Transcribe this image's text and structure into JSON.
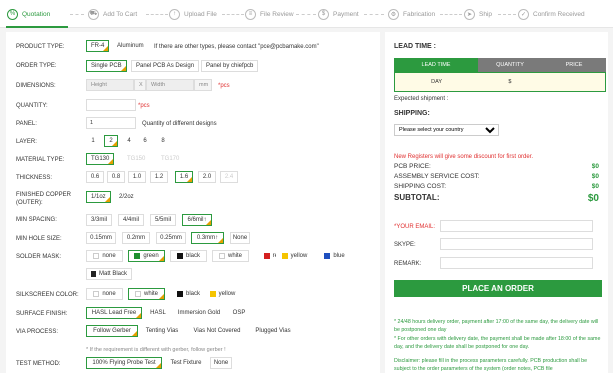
{
  "steps": [
    {
      "label": "Quotation",
      "icon": "percent-icon"
    },
    {
      "label": "Add To Cart",
      "icon": "cart-icon"
    },
    {
      "label": "Upload File",
      "icon": "upload-icon"
    },
    {
      "label": "File Review",
      "icon": "file-review-icon"
    },
    {
      "label": "Payment",
      "icon": "dollar-icon"
    },
    {
      "label": "Fabrication",
      "icon": "fabrication-icon"
    },
    {
      "label": "Ship",
      "icon": "ship-icon"
    },
    {
      "label": "Confirm Received",
      "icon": "check-circle-icon"
    }
  ],
  "form": {
    "product_type": {
      "label": "PRODUCT TYPE:",
      "opt1": "FR-4",
      "opt2": "Aluminum",
      "note": "If there are other types, please contact \"pce@pcbamake.com\""
    },
    "order_type": {
      "label": "ORDER TYPE:",
      "opt1": "Single PCB",
      "opt2": "Panel PCB As Design",
      "opt3": "Panel by chiefpcb"
    },
    "dimensions": {
      "label": "DIMENSIONS:",
      "height_ph": "Height",
      "x": "X",
      "width_ph": "Width",
      "unit": "mm",
      "unit_note": "*pcs"
    },
    "quantity": {
      "label": "QUANTITY:",
      "unit": "*pcs"
    },
    "panel": {
      "label": "PANEL:",
      "value": "1",
      "note": "Quantity of different designs"
    },
    "layer": {
      "label": "LAYER:",
      "opts": [
        "1",
        "2",
        "4",
        "6",
        "8"
      ]
    },
    "material": {
      "label": "MATERIAL TYPE:",
      "opts": [
        "TG130",
        "TG150",
        "TG170"
      ]
    },
    "thickness": {
      "label": "THICKNESS:",
      "opts": [
        "0.6",
        "0.8",
        "1.0",
        "1.2",
        "1.6",
        "2.0",
        "2.4"
      ]
    },
    "copper": {
      "label1": "FINISHED COPPER",
      "label2": "(OUTER):",
      "opts": [
        "1/1oz",
        "2/2oz"
      ]
    },
    "spacing": {
      "label": "MIN SPACING:",
      "opts": [
        "3/3mil",
        "4/4mil",
        "5/5mil",
        "6/6mil↑"
      ]
    },
    "hole": {
      "label": "MIN HOLE SIZE:",
      "opts": [
        "0.15mm",
        "0.2mm",
        "0.25mm",
        "0.3mm↑",
        "None"
      ]
    },
    "mask": {
      "label": "SOLDER MASK:",
      "opts": [
        "none",
        "green",
        "black",
        "white",
        "red",
        "yellow",
        "blue",
        "Matt Black"
      ]
    },
    "silk": {
      "label": "SILKSCREEN COLOR:",
      "opts": [
        "none",
        "white",
        "black",
        "yellow"
      ]
    },
    "finish": {
      "label": "SURFACE FINISH:",
      "opts": [
        "HASL Lead Free",
        "HASL",
        "Immersion Gold",
        "OSP"
      ]
    },
    "via": {
      "label": "VIA PROCESS:",
      "opts": [
        "Follow Gerber",
        "Tenting Vias",
        "Vias Not Covered",
        "Plugged Vias"
      ],
      "note": "* If the requirement is different with gerber, follow gerber !"
    },
    "test": {
      "label": "TEST METHOD:",
      "opts": [
        "100% Flying Probe Test",
        "Test Fixture",
        "None"
      ]
    }
  },
  "colors": {
    "green": "#1e8f2e",
    "black": "#111111",
    "white": "#ffffff",
    "red": "#d42020",
    "yellow": "#f5c400",
    "blue": "#1f4fbf",
    "mattblack": "#222222",
    "accent": "#2c9a3f",
    "header": "#777777"
  },
  "right": {
    "lead_time_title": "LEAD TIME :",
    "table_headers": [
      "LEAD TIME",
      "QUANTITY",
      "PRICE"
    ],
    "table_row": {
      "lead": "DAY",
      "qty": "$",
      "price": ""
    },
    "expected": "Expected shipment :",
    "shipping_title": "SHIPPING:",
    "country_placeholder": "Please select your country",
    "discount": "New Registers will give some discount for first order.",
    "pcb_price": {
      "label": "PCB PRICE:",
      "value": "$0"
    },
    "assembly": {
      "label": "ASSEMBLY SERVICE COST:",
      "value": "$0"
    },
    "shipping_cost": {
      "label": "SHIPPING COST:",
      "value": "$0"
    },
    "subtotal": {
      "label": "SUBTOTAL:",
      "value": "$0"
    },
    "email_label": "*YOUR EMAIL:",
    "skype_label": "SKYPE:",
    "remark_label": "REMARK:",
    "order_button": "PLACE AN ORDER",
    "note1": "* 24/48 hours delivery order, payment after 17:00 of the same day, the delivery date will be postponed one day",
    "note2": "* For other orders with delivery date, the payment shall be made after 18:00 of the same day, and the delivery date shall be postponed for one day.",
    "note3": "Disclaimer: please fill in the process parameters carefully. PCB production shall be subject to the order parameters of the system (order notes, PCB file"
  }
}
